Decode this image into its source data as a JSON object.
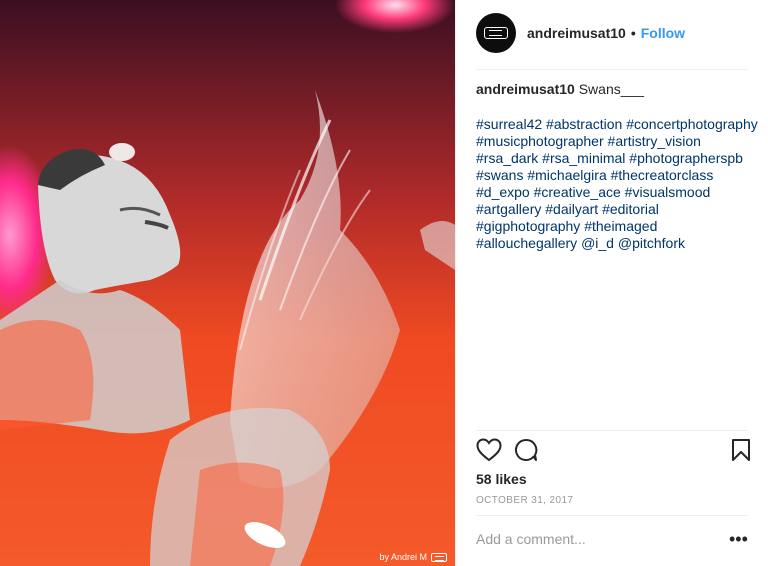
{
  "post": {
    "photo": {
      "alt": "",
      "watermark_text": "by Andrei M",
      "colors": {
        "base": "#f04a22",
        "glow": "#ff2a6a",
        "dark": "#2a0f1a"
      }
    },
    "header": {
      "username": "andreimusat10",
      "separator": "•",
      "follow_label": "Follow",
      "avatar_icon": "am-logo-icon"
    },
    "caption": {
      "username": "andreimusat10",
      "text": "Swans___",
      "tags": [
        "#surreal42",
        "#abstraction",
        "#concertphotography",
        "#musicphotographer",
        "#artistry_vision",
        "#rsa_dark",
        "#rsa_minimal",
        "#photographerspb",
        "#swans",
        "#michaelgira",
        "#thecreatorclass",
        "#d_expo",
        "#creative_ace",
        "#visualsmood",
        "#artgallery",
        "#dailyart",
        "#editorial",
        "#gigphotography",
        "#theimaged",
        "#allouchegallery",
        "@i_d",
        "@pitchfork"
      ]
    },
    "actions": {
      "like_icon": "heart-icon",
      "comment_icon": "comment-bubble-icon",
      "save_icon": "bookmark-icon"
    },
    "likes_text": "58 likes",
    "date": "OCTOBER 31, 2017",
    "comment": {
      "placeholder": "Add a comment...",
      "more_label": "•••"
    },
    "theme": {
      "link_color": "#003569",
      "follow_color": "#3897f0",
      "muted_color": "#999999"
    }
  }
}
